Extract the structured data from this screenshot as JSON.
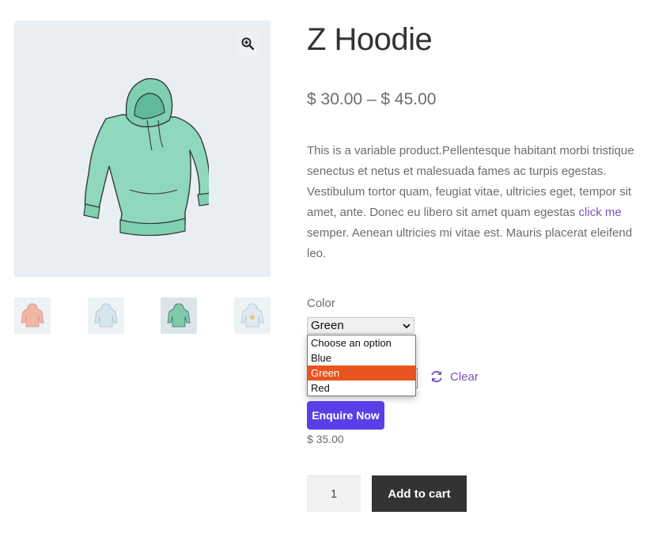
{
  "product": {
    "title": "Z Hoodie",
    "price_range": "$ 30.00 – $ 45.00",
    "description_before": "This is a variable product.Pellentesque habitant morbi tristique senectus et netus et malesuada fames ac turpis egestas. Vestibulum tortor quam, feugiat vitae, ultricies eget, tempor sit amet, ante. Donec eu libero sit amet quam egestas ",
    "description_link": "click me",
    "description_after": " semper. Aenean ultricies mi vitae est. Mauris placerat eleifend leo.",
    "main_image_icon": "hoodie-green-icon",
    "zoom_icon": "zoom-in-icon"
  },
  "gallery": {
    "thumbnails": [
      {
        "icon": "hoodie-pink-icon",
        "color": "#f2b6a6"
      },
      {
        "icon": "hoodie-blue-icon",
        "color": "#d6e6ee"
      },
      {
        "icon": "hoodie-green-icon",
        "color": "#7fc9ad"
      },
      {
        "icon": "hoodie-logo-icon",
        "color": "#dfe9f0"
      }
    ]
  },
  "variation": {
    "label": "Color",
    "selected": "Green",
    "options": [
      "Choose an option",
      "Blue",
      "Green",
      "Red"
    ],
    "highlighted_option": "Green",
    "clear_label": "Clear",
    "clear_icon": "refresh-icon"
  },
  "enquire": {
    "label": "Enquire Now",
    "color": "#5b3ee8"
  },
  "variant_price": "$ 35.00",
  "cart": {
    "quantity": "1",
    "add_label": "Add to cart"
  },
  "colors": {
    "accent": "#7f54b3",
    "highlight": "#e95420",
    "dark_button": "#333333"
  }
}
